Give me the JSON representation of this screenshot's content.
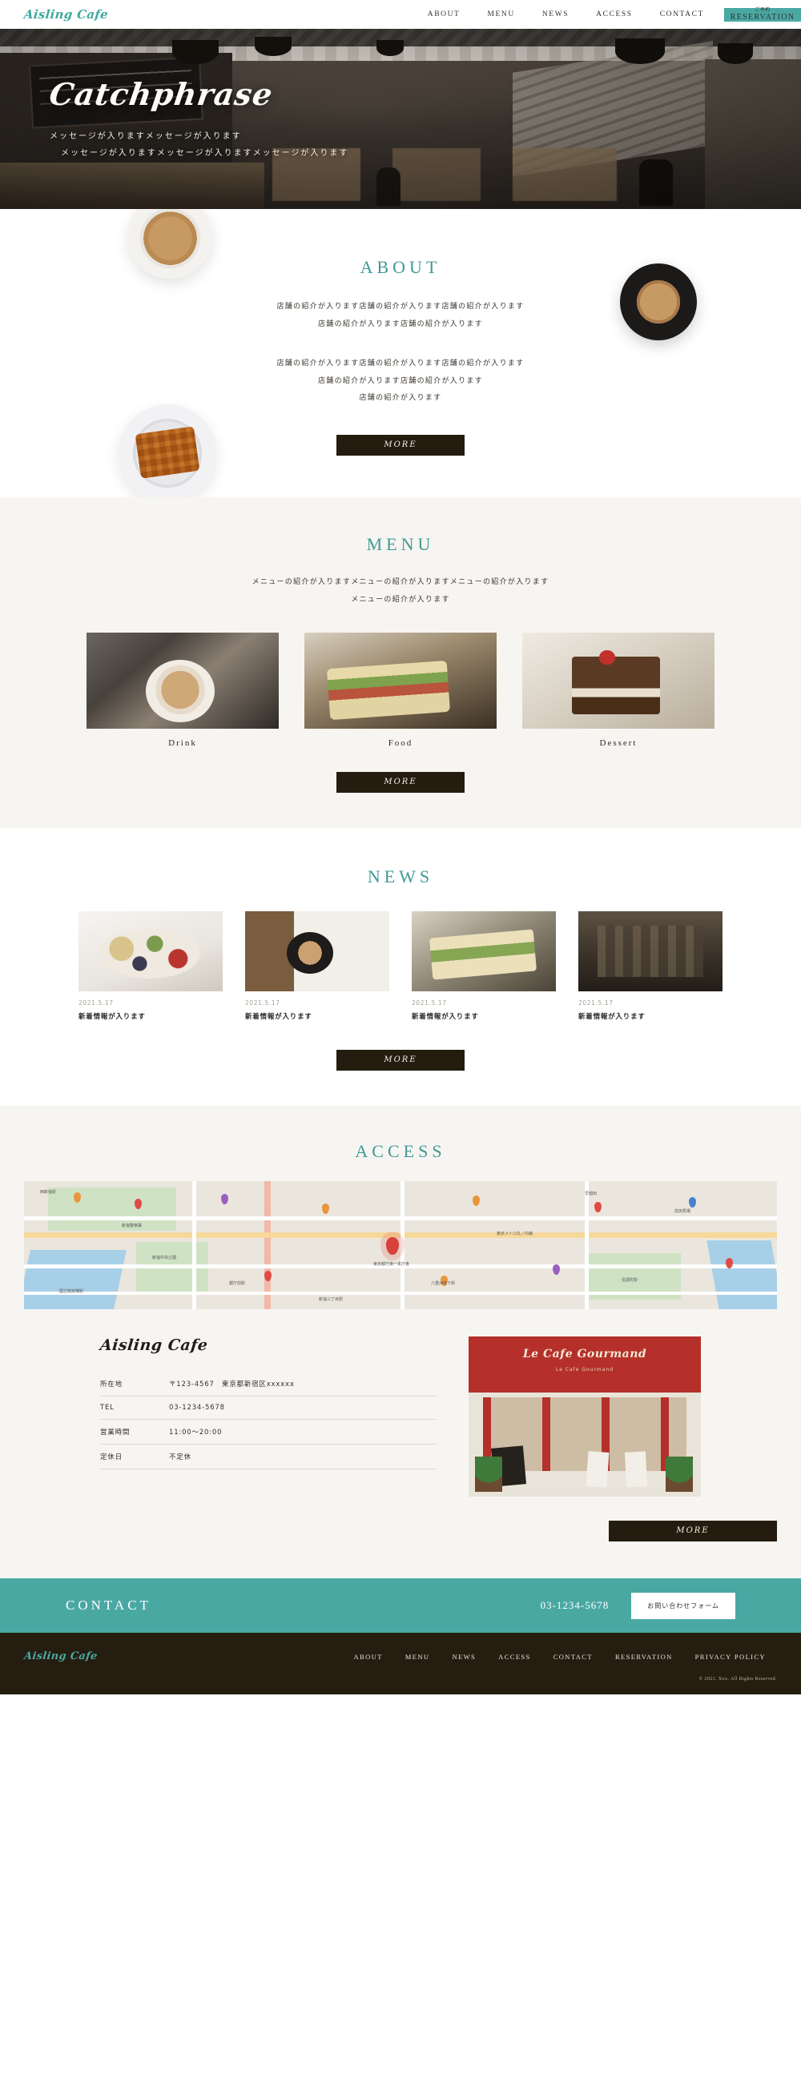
{
  "site": {
    "brand": "Aisling Cafe"
  },
  "header": {
    "nav": [
      {
        "label": "ABOUT"
      },
      {
        "label": "MENU"
      },
      {
        "label": "NEWS"
      },
      {
        "label": "ACCESS"
      },
      {
        "label": "CONTACT"
      }
    ],
    "reservation": {
      "jp_label": "ご予約",
      "en_label": "RESERVATION",
      "bg_color": "#4aa8a3"
    }
  },
  "hero": {
    "catchphrase": "Catchphrase",
    "message_line1": "メッセージが入りますメッセージが入ります",
    "message_line2": "メッセージが入りますメッセージが入りますメッセージが入ります"
  },
  "about": {
    "title": "ABOUT",
    "paragraph1_line1": "店舗の紹介が入ります店舗の紹介が入ります店舗の紹介が入ります",
    "paragraph1_line2": "店舗の紹介が入ります店舗の紹介が入ります",
    "paragraph2_line1": "店舗の紹介が入ります店舗の紹介が入ります店舗の紹介が入ります",
    "paragraph2_line2": "店舗の紹介が入ります店舗の紹介が入ります",
    "paragraph2_line3": "店舗の紹介が入ります",
    "more_label": "MORE"
  },
  "menu": {
    "title": "MENU",
    "lead_line1": "メニューの紹介が入りますメニューの紹介が入りますメニューの紹介が入ります",
    "lead_line2": "メニューの紹介が入ります",
    "cards": [
      {
        "label": "Drink"
      },
      {
        "label": "Food"
      },
      {
        "label": "Dessert"
      }
    ],
    "more_label": "MORE"
  },
  "news": {
    "title": "NEWS",
    "items": [
      {
        "date": "2021.5.17",
        "title": "新着情報が入ります"
      },
      {
        "date": "2021.5.17",
        "title": "新着情報が入ります"
      },
      {
        "date": "2021.5.17",
        "title": "新着情報が入ります"
      },
      {
        "date": "2021.5.17",
        "title": "新着情報が入ります"
      }
    ],
    "more_label": "MORE"
  },
  "access": {
    "title": "ACCESS",
    "shop_name": "Aisling Cafe",
    "info": [
      {
        "label": "所在地",
        "value": "〒123-4567　東京都新宿区xxxxxx"
      },
      {
        "label": "TEL",
        "value": "03-1234-5678"
      },
      {
        "label": "営業時間",
        "value": "11:00〜20:00"
      },
      {
        "label": "定休日",
        "value": "不定休"
      }
    ],
    "photo": {
      "shop_sign": "Le Cafe Gourmand",
      "shop_sign_sub": "Le Cafe Gourmand"
    },
    "more_label": "MORE",
    "map_labels": [
      "西新宿駅",
      "新宿警察署",
      "都庁前駅",
      "東京都庁第一本庁舎",
      "八重洲地下街",
      "新宿中央公園",
      "高田馬場",
      "早稲田",
      "東京メトロ丸ノ内線",
      "新宿三丁目駅",
      "国立競技場駅",
      "信濃町駅"
    ]
  },
  "contact": {
    "title": "CONTACT",
    "tel": "03-1234-5678",
    "form_button": "お問い合わせフォーム",
    "bg_color": "#4aa8a3"
  },
  "footer": {
    "brand": "Aisling Cafe",
    "nav": [
      {
        "label": "ABOUT"
      },
      {
        "label": "MENU"
      },
      {
        "label": "NEWS"
      },
      {
        "label": "ACCESS"
      },
      {
        "label": "CONTACT"
      },
      {
        "label": "RESERVATION"
      },
      {
        "label": "PRIVACY POLICY"
      }
    ],
    "copyright": "© 2021. Xxx. All Rights Reserved."
  }
}
